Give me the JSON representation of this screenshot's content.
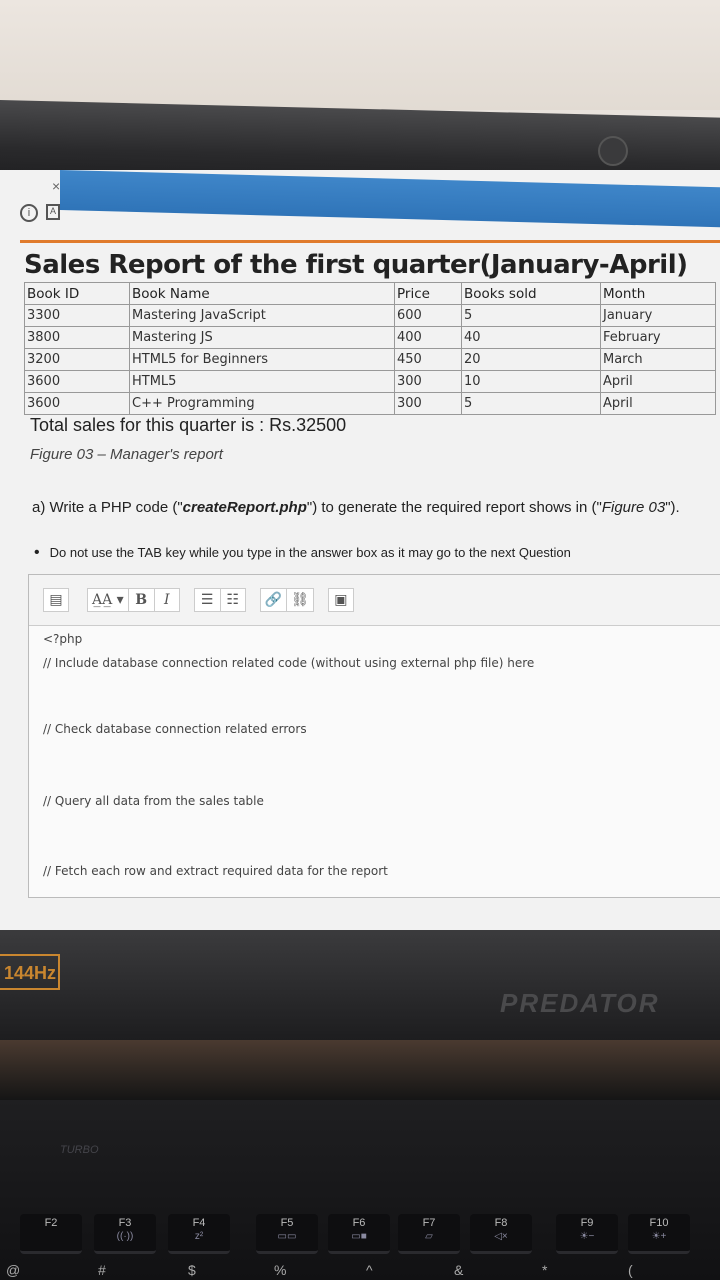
{
  "tab": {
    "close_glyph": "×"
  },
  "toolbar_icons": [
    {
      "name": "info-icon",
      "glyph": "i"
    },
    {
      "name": "pdf-icon",
      "glyph": "A"
    }
  ],
  "report": {
    "title": "Sales Report of the first quarter(January-April)",
    "columns": [
      "Book ID",
      "Book Name",
      "Price",
      "Books sold",
      "Month"
    ],
    "rows": [
      [
        "3300",
        "Mastering JavaScript",
        "600",
        "5",
        "January"
      ],
      [
        "3800",
        "Mastering JS",
        "400",
        "40",
        "February"
      ],
      [
        "3200",
        "HTML5 for Beginners",
        "450",
        "20",
        "March"
      ],
      [
        "3600",
        "HTML5",
        "300",
        "10",
        "April"
      ],
      [
        "3600",
        "C++ Programming",
        "300",
        "5",
        "April"
      ]
    ],
    "total": "Total sales for this quarter is : Rs.32500",
    "caption": "Figure 03 – Manager's report"
  },
  "question": {
    "prefix": "a)  Write a PHP code (\"",
    "filename": "createReport.php",
    "middle": "\") to generate the required report shows in (\"",
    "figure_ref": "Figure 03",
    "suffix": "\")."
  },
  "note": "Do not use the TAB key while you type in the answer box as it may go to the next Question",
  "editor": {
    "toolbar": {
      "font_size": "A̲A̲ ▾",
      "bold": "B",
      "italic": "I",
      "bullet_list": "☰",
      "numbered_list": "☷",
      "link": "🔗",
      "unlink": "⛓",
      "image": "▣",
      "show_more": "▤"
    },
    "lines": [
      "<?php",
      "// Include database connection related code (without using external php file)  here",
      "",
      "",
      "// Check database connection related errors",
      "",
      "",
      "// Query all data from the sales table",
      "",
      "",
      "// Fetch each row  and extract required data for the report"
    ]
  },
  "device": {
    "refresh_badge": "144Hz",
    "brand": "PREDATOR",
    "turbo_label": "TURBO",
    "fkeys": [
      {
        "label": "F2",
        "sub": ""
      },
      {
        "label": "F3",
        "sub": "((·))"
      },
      {
        "label": "F4",
        "sub": "z²"
      },
      {
        "label": "F5",
        "sub": "▭▭"
      },
      {
        "label": "F6",
        "sub": "▭■"
      },
      {
        "label": "F7",
        "sub": "▱"
      },
      {
        "label": "F8",
        "sub": "◁×"
      },
      {
        "label": "F9",
        "sub": "☀−"
      },
      {
        "label": "F10",
        "sub": "☀+"
      }
    ],
    "number_row": [
      "@",
      "#",
      "$",
      "%",
      "^",
      "&",
      "*",
      "("
    ]
  }
}
